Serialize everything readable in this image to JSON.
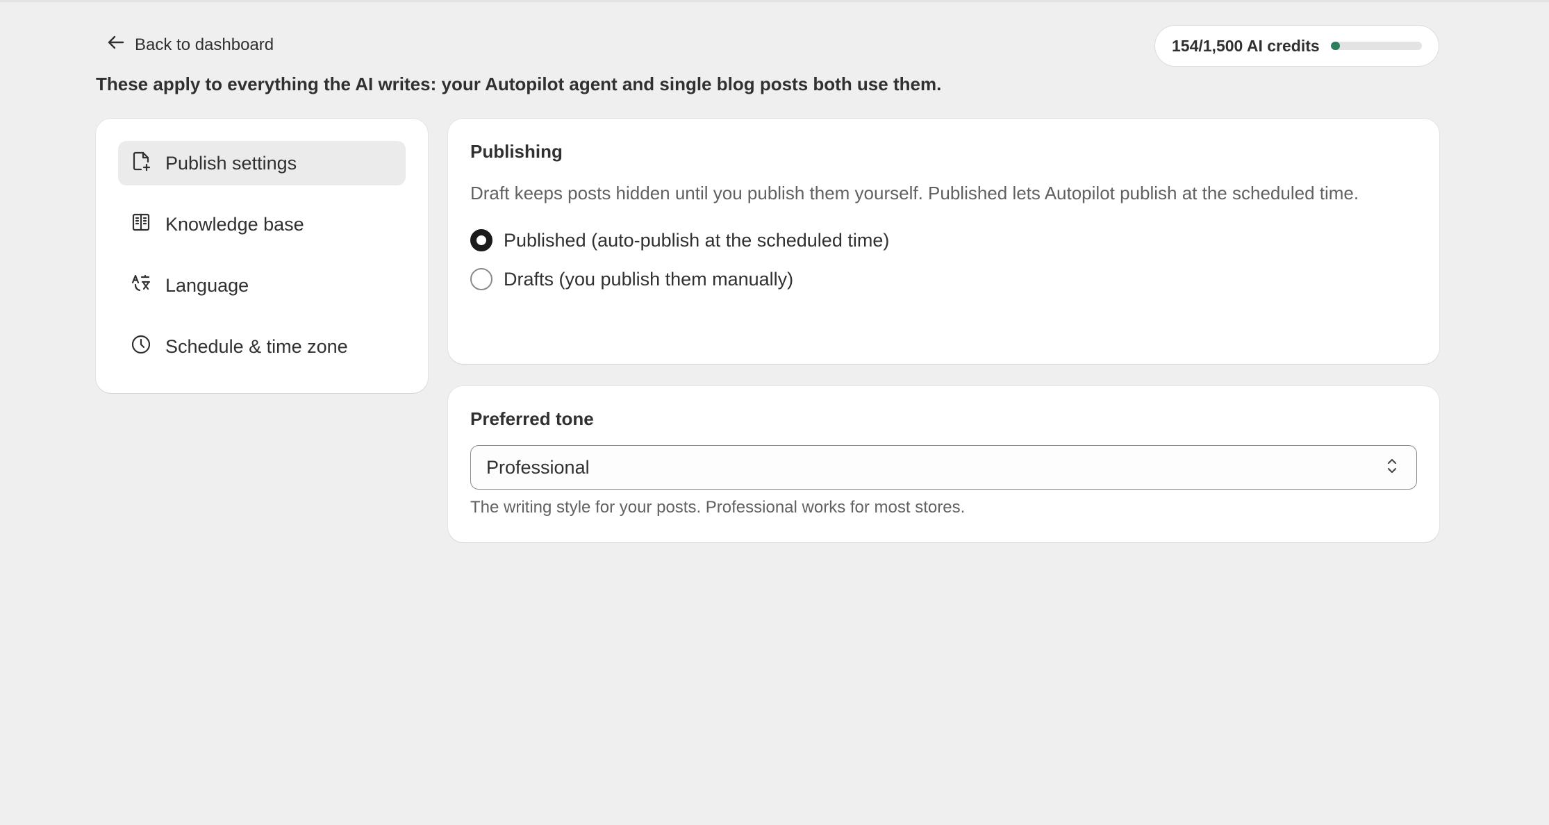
{
  "header": {
    "back_label": "Back to dashboard",
    "credits_label": "154/1,500 AI credits",
    "credits_used": 154,
    "credits_total": 1500,
    "credits_fraction": 0.103,
    "credits_color": "#2e7d5b"
  },
  "intro": "These apply to everything the AI writes: your Autopilot agent and single blog posts both use them.",
  "nav": {
    "items": [
      {
        "label": "Publish settings",
        "icon": "document-plus-icon",
        "active": true
      },
      {
        "label": "Knowledge base",
        "icon": "book-icon",
        "active": false
      },
      {
        "label": "Language",
        "icon": "translate-icon",
        "active": false
      },
      {
        "label": "Schedule & time zone",
        "icon": "clock-icon",
        "active": false
      }
    ]
  },
  "publishing": {
    "title": "Publishing",
    "description": "Draft keeps posts hidden until you publish them yourself. Published lets Autopilot publish at the scheduled time.",
    "options": [
      {
        "label": "Published (auto-publish at the scheduled time)",
        "checked": true
      },
      {
        "label": "Drafts (you publish them manually)",
        "checked": false
      }
    ]
  },
  "tone": {
    "title": "Preferred tone",
    "selected": "Professional",
    "help": "The writing style for your posts. Professional works for most stores."
  }
}
